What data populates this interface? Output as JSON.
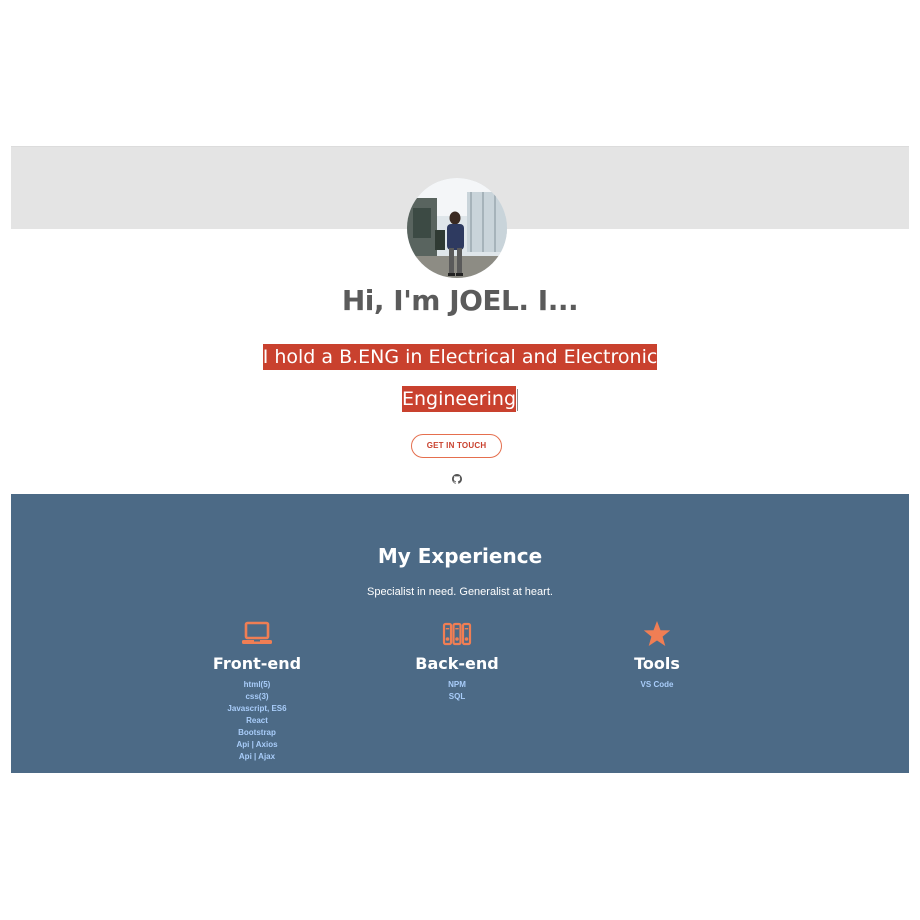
{
  "hero": {
    "title": "Hi, I'm JOEL. I...",
    "subtitle_line1": "I hold a B.ENG in Electrical and Electronic",
    "subtitle_line2": "Engineering",
    "cta_label": "GET IN TOUCH",
    "github_icon": "github-icon",
    "avatar_icon": "profile-photo"
  },
  "experience": {
    "title": "My Experience",
    "subtitle": "Specialist in need. Generalist at heart.",
    "accent": "#f07e54",
    "columns": [
      {
        "title": "Front-end",
        "icon": "laptop-icon",
        "items": [
          "html(5)",
          "css(3)",
          "Javascript, ES6",
          "React",
          "Bootstrap",
          "Api | Axios",
          "Api | Ajax"
        ]
      },
      {
        "title": "Back-end",
        "icon": "server-icon",
        "items": [
          "NPM",
          "SQL"
        ]
      },
      {
        "title": "Tools",
        "icon": "star-icon",
        "items": [
          "VS Code"
        ]
      }
    ]
  },
  "colors": {
    "banner": "#e4e4e4",
    "highlight": "#c9412e",
    "section_bg": "#4c6a86",
    "link": "#a9cdfa"
  }
}
